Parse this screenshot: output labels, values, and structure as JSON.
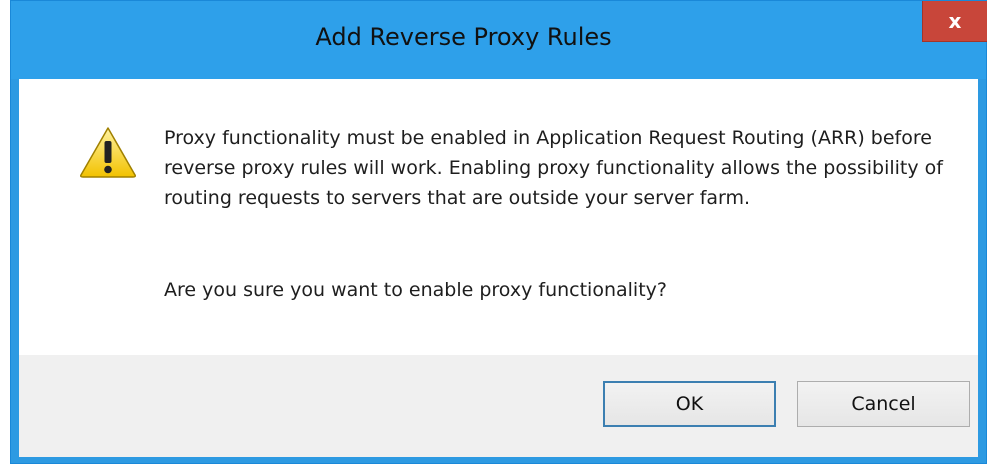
{
  "dialog": {
    "title": "Add Reverse Proxy Rules",
    "close_label": "x",
    "icon": "warning-icon",
    "message": "Proxy functionality must be enabled in Application Request Routing (ARR) before reverse proxy rules will work. Enabling proxy functionality allows the possibility of routing requests to servers that are outside your server farm.",
    "question": "Are you sure you want to enable proxy functionality?",
    "buttons": {
      "ok": "OK",
      "cancel": "Cancel"
    }
  },
  "colors": {
    "titlebar": "#2ea0ea",
    "close": "#c8463a",
    "footer": "#f0f0f0"
  }
}
